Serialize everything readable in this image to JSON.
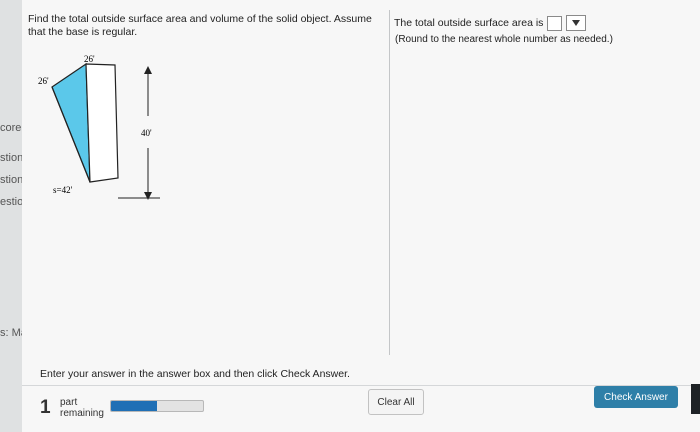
{
  "sidebar": {
    "fragments": [
      "core",
      "stion",
      "stion",
      "estion",
      "s: Math"
    ]
  },
  "question": {
    "text": "Find the total outside surface area and volume of the solid object. Assume that the base is regular."
  },
  "answer": {
    "prompt": "The total outside surface area is",
    "note": "(Round to the nearest whole number as needed.)",
    "input_value": "",
    "dropdown_value": ""
  },
  "figure": {
    "label_top": "26'",
    "label_left": "26'",
    "label_height": "40'",
    "label_slant": "s=42'",
    "colors": {
      "fill": "#5bc8ea",
      "stroke": "#222222"
    }
  },
  "footer": {
    "instruction": "Enter your answer in the answer box and then click Check Answer.",
    "part_number": "1",
    "part_label": "part",
    "remaining_label": "remaining",
    "progress_fraction": 0.5,
    "clear_label": "Clear All",
    "check_label": "Check Answer"
  },
  "colors": {
    "accent": "#2e7fa8",
    "progress": "#1f6fb5"
  }
}
